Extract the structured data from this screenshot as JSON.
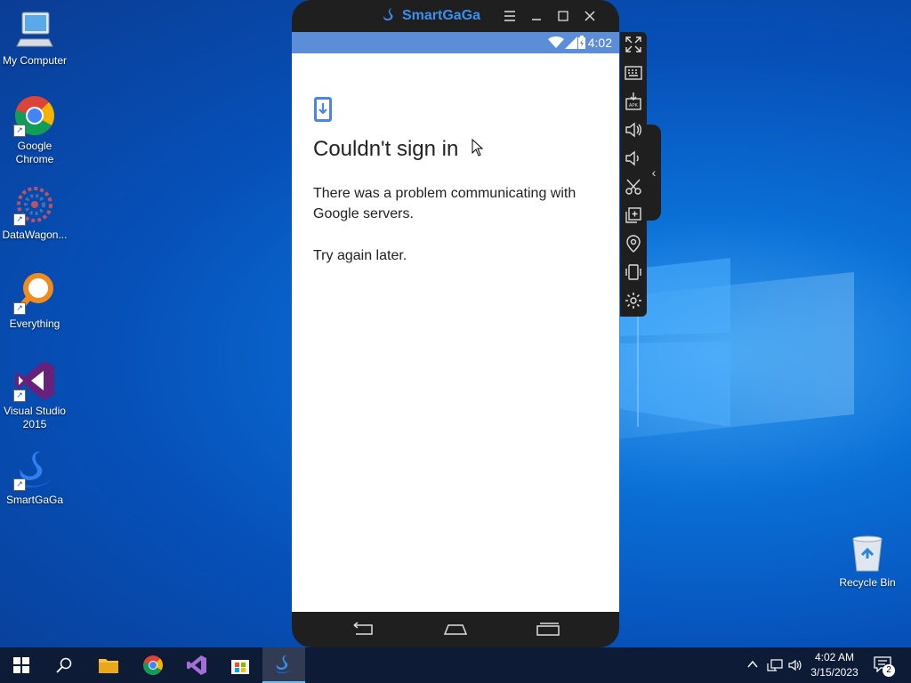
{
  "desktop": {
    "icons": [
      {
        "label": "My Computer"
      },
      {
        "label": "Google Chrome"
      },
      {
        "label": "DataWagon..."
      },
      {
        "label": "Everything"
      },
      {
        "label": "Visual Studio 2015"
      },
      {
        "label": "SmartGaGa"
      }
    ],
    "recycle_bin": "Recycle Bin"
  },
  "emulator": {
    "title": "SmartGaGa",
    "statusbar": {
      "time": "4:02"
    },
    "dialog": {
      "title": "Couldn't sign in",
      "message": "There was a problem communicating with Google servers.",
      "hint": "Try again later."
    }
  },
  "taskbar": {
    "time": "4:02 AM",
    "date": "3/15/2023",
    "notification_count": "2"
  },
  "colors": {
    "status_bar": "#5b8ed6",
    "brand": "#3a8ff0",
    "taskbar": "#0d1b36"
  }
}
